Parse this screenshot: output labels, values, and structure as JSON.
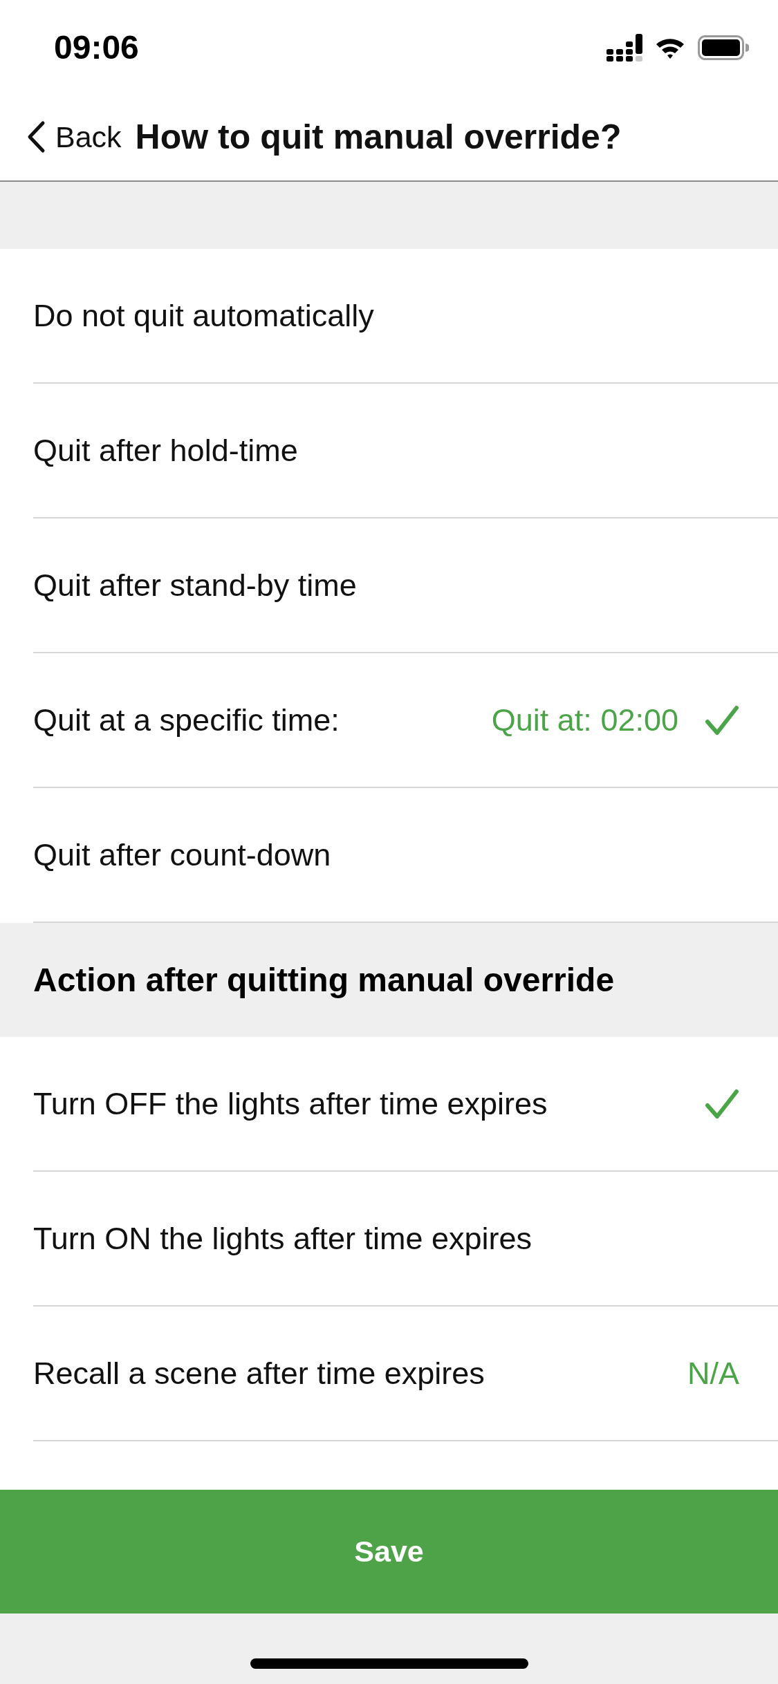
{
  "status_bar": {
    "time": "09:06"
  },
  "nav_bar": {
    "back_label": "Back",
    "title": "How to quit manual override?"
  },
  "quit_options": [
    {
      "label": "Do not quit automatically",
      "selected": false
    },
    {
      "label": "Quit after hold-time",
      "selected": false
    },
    {
      "label": "Quit after stand-by time",
      "selected": false
    },
    {
      "label": "Quit at a specific time:",
      "value": "Quit at: 02:00",
      "selected": true
    },
    {
      "label": "Quit after count-down",
      "selected": false
    }
  ],
  "action_section": {
    "title": "Action after quitting manual override",
    "options": [
      {
        "label": "Turn OFF the lights after time expires",
        "selected": true
      },
      {
        "label": "Turn ON the lights after time expires",
        "selected": false
      },
      {
        "label": "Recall a scene after time expires",
        "value": "N/A",
        "selected": false
      }
    ]
  },
  "save_button": {
    "label": "Save"
  }
}
